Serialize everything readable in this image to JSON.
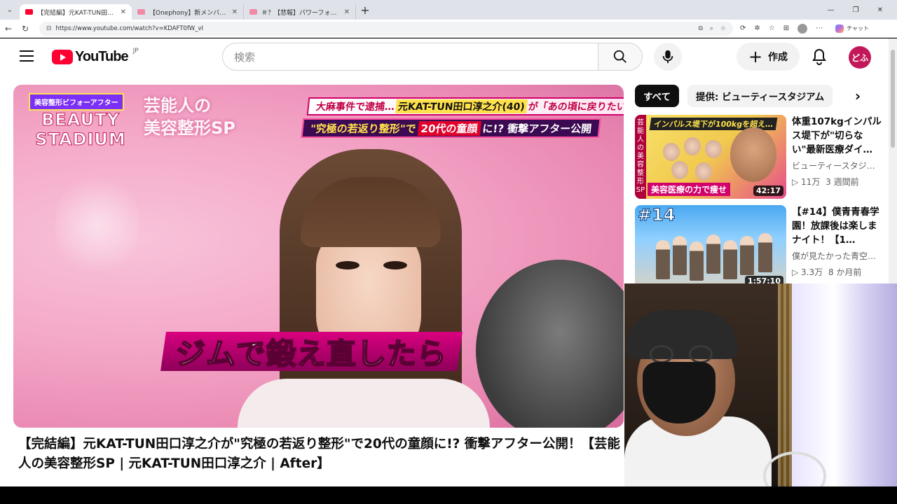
{
  "browser": {
    "tabs": [
      {
        "title": "【完結編】元KAT-TUN田口淳之介",
        "active": true,
        "fav": "youtube"
      },
      {
        "title": "【Onephony】新メンバーオーディション",
        "active": false,
        "fav": "pink"
      },
      {
        "title": "＃？【悲報】パワーフォース最終決戦",
        "active": false,
        "fav": "pink"
      }
    ],
    "new_tab": "+",
    "url": "https://www.youtube.com/watch?v=KDAFT0fW_vI",
    "chat_label": "チャット"
  },
  "masthead": {
    "logo_text": "YouTube",
    "region": "JP",
    "search_placeholder": "検索",
    "create_label": "作成",
    "avatar_text": "どふ"
  },
  "video": {
    "title": "【完結編】元KAT-TUN田口淳之介が\"究極の若返り整形\"で20代の童顔に!? 衝撃アフター公開！【芸能人の美容整形SP | 元KAT-TUN田口淳之介 | After】",
    "overlay": {
      "badge_tag": "美容整形ビフォーアフター",
      "badge_title": "BEAUTY STADIUM",
      "sp_title_line1": "芸能人の",
      "sp_title_line2": "美容整形SP",
      "headline1_a": "大麻事件で逮捕…",
      "headline1_b": "元KAT-TUN田口淳之介(40)",
      "headline1_c": "が「あの頃に戻りたい」",
      "headline2_a": "\"究極の若返り整形\"で",
      "headline2_b": "20代の童顔",
      "headline2_c": "に!? 衝撃アフター公開",
      "caption": "ジムで鍛え直したら"
    }
  },
  "sidebar": {
    "chips": [
      "すべて",
      "提供: ビューティースタジアム"
    ],
    "recommendations": [
      {
        "title": "体重107kgインパルス堤下が\"切らない\"最新医療ダイ…",
        "channel": "ビューティースタジ…",
        "views": "11万",
        "age": "3 週間前",
        "duration": "42:17",
        "thumb_top": "インパルス堤下が100kgを超え…",
        "thumb_bottom": "美容医療の力で痩せ",
        "thumb_strip": "芸能人の美容整形SP"
      },
      {
        "title": "【#14】僕青青春学園！放課後は楽しまナイト！【1…",
        "channel": "僕が見たかった青空…",
        "views": "3.3万",
        "age": "8 か月前",
        "duration": "1:57:10",
        "thumb_num": "#14"
      }
    ]
  },
  "colors": {
    "youtube_red": "#ff0033",
    "avatar_bg": "#c2185b",
    "chip_selected": "#0f0f0f"
  }
}
